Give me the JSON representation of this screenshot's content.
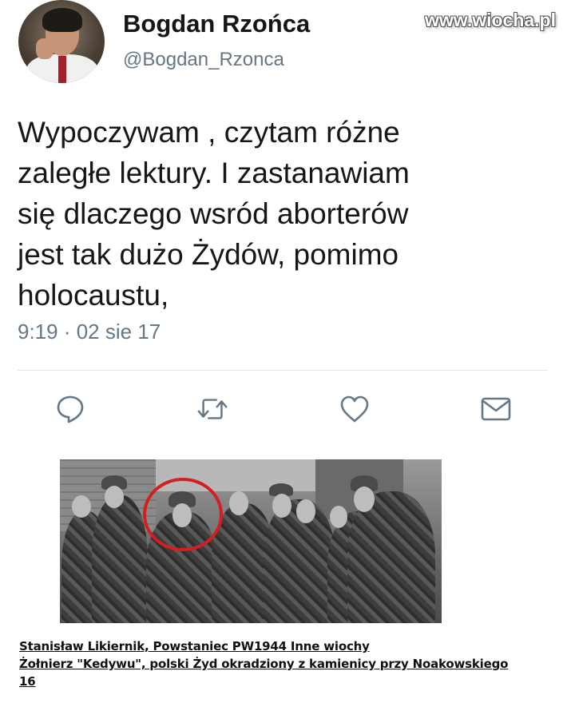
{
  "watermark": "www.wiocha.pl",
  "user": {
    "display_name": "Bogdan Rzońca",
    "handle": "@Bogdan_Rzonca"
  },
  "tweet": {
    "lines": [
      "Wypoczywam , czytam różne",
      "zaległe lektury. I zastanawiam",
      "się dlaczego wsród aborterów",
      "jest tak dużo Żydów, pomimo",
      "holocaustu,"
    ],
    "timestamp": "9:19 · 02 sie 17"
  },
  "actions": [
    {
      "name": "reply",
      "icon": "speech-bubble-icon"
    },
    {
      "name": "retweet",
      "icon": "retweet-arrows-icon"
    },
    {
      "name": "like",
      "icon": "heart-icon"
    },
    {
      "name": "message",
      "icon": "envelope-icon"
    }
  ],
  "colors": {
    "text": "#14171a",
    "muted": "#657786",
    "icon": "#657786",
    "divider": "#e1e8ed",
    "highlight_circle": "#d21f1f"
  },
  "caption": {
    "lines": [
      "Stanisław Likiernik, Powstaniec PW1944 Inne wiochy",
      "Żołnierz \"Kedywu\", polski Żyd okradziony z kamienicy przy Noakowskiego",
      "16"
    ]
  }
}
